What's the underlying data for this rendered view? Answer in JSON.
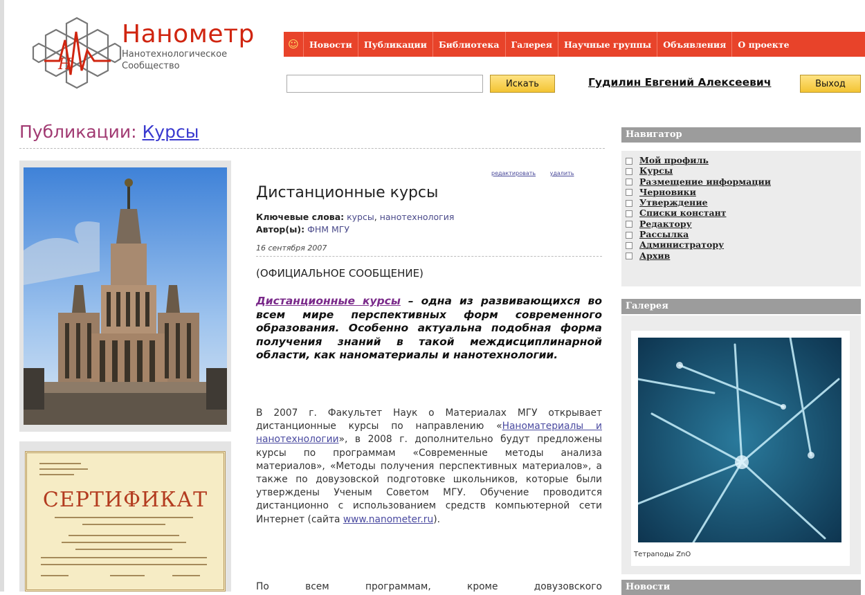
{
  "header": {
    "logo_title": "Нанометр",
    "logo_sub1": "Нанотехнологическое",
    "logo_sub2": "Сообщество",
    "nav": [
      "Новости",
      "Публикации",
      "Библиотека",
      "Галерея",
      "Научные группы",
      "Объявления",
      "О проекте"
    ],
    "search_placeholder": "",
    "search_button": "Искать",
    "user_name": "Гудилин Евгений Алексеевич",
    "logout_button": "Выход"
  },
  "page": {
    "section": "Публикации",
    "colon": ": ",
    "subsection": "Курсы"
  },
  "article": {
    "edit_link": "редактировать",
    "delete_link": "удалить",
    "title": "Дистанционные курсы",
    "keywords_label": "Ключевые слова:",
    "keyword1": "курсы",
    "keyword2": "нанотехнология",
    "authors_label": "Автор(ы):",
    "author": "ФНМ МГУ",
    "date": "16 сентября 2007",
    "official": "(ОФИЦИАЛЬНОЕ СООБЩЕНИЕ)",
    "lead_link": "Дистанционные курсы",
    "lead_text": " – одна из развивающихся во всем мире перспективных форм современного образования. Особенно актуальна подобная форма получения знаний в такой междисциплинарной области, как наноматериалы и нанотехнологии.",
    "body_1": "В 2007 г. Факультет Наук о Материалах МГУ открывает дистанционные курсы по направлению «",
    "body_link": "Наноматериалы и нанотехнологии",
    "body_2": "», в 2008 г. дополнительно будут предложены курсы по программам «Современные методы анализа материалов», «Методы получения перспективных материалов», а также по довузовской подготовке школьников, которые были утверждены Ученым Советом МГУ. Обучение проводится дистанционно с использованием средств компьютерной сети Интернет (сайта ",
    "body_site": "www.nanometer.ru",
    "body_3": ").",
    "body_next": [
      "По",
      "всем",
      "программам,",
      "кроме",
      "довузовского"
    ],
    "cert_title": "СЕРТИФИКАТ"
  },
  "sidebar": {
    "navigator_title": "Навигатор",
    "nav_items": [
      "Мой профиль",
      "Курсы",
      "Размещение информации",
      "Черновики",
      "Утверждение",
      "Списки констант",
      "Редактору",
      "Рассылка",
      "Администратору",
      "Архив"
    ],
    "gallery_title": "Галерея",
    "gallery_caption": "Тетраподы ZnO",
    "news_title": "Новости"
  }
}
